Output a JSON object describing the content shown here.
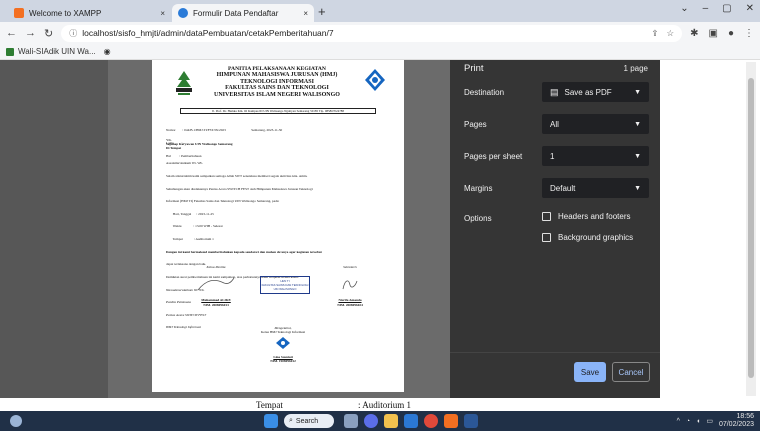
{
  "browser": {
    "tabs": [
      {
        "title": "Welcome to XAMPP",
        "close": "×"
      },
      {
        "title": "Formulir Data Pendaftar",
        "close": "×"
      }
    ],
    "new_tab": "+",
    "window_controls": [
      "⌄",
      "–",
      "▢",
      "✕"
    ],
    "url": "localhost/sisfo_hmjti/admin/dataPembuatan/cetakPemberitahuan/7",
    "bookmarks": [
      "Wali-SIAdik UIN Wa..."
    ]
  },
  "document": {
    "header_lines": [
      "PANITIA PELAKSANAAN KEGIATAN",
      "HIMPUNAN MAHASISWA JURUSAN (HMJ)",
      "TEKNOLOGI INFORMASI",
      "FAKULTAS SAINS DAN TEKNOLOGI",
      "UNIVERSITAS ISLAM NEGERI WALISONGO"
    ],
    "address": "Jl. Prof. Dr. Hamka Km. 02 Kampus III UIN Walisongo Ngaliyan Semarang 50185 Tlp. 085867024788",
    "meta_lines": [
      "Nomor        : 044/B.1/HMJ.TI/FST/IX/2023                              Semarang, 2023-11-30",
      "Lamp         : -",
      "Hal          : Pemberitahuan"
    ],
    "to_lines": [
      "Yth.",
      "Segenap Karyawan UIN Walisongo Semarang",
      "Di Tempat"
    ],
    "body_lines": [
      "Assalamu'alaikum Wr. Wb.",
      "Salam silaturrahim kami sampaikan semoga Allah SWT senantiasa memberi segala aktivitas kita. Amin.",
      "Sehubungan akan diadakannya Pentas Acara SWITCH FEST oleh Himpunan Mahasiswa Jurusan Teknologi",
      "Informasi (HMJ TI) Fakultas Sains dan Teknologi UIN Walisongo Semarang, pada:",
      "        Hari, Tanggal      : 2023-11-25",
      "        Waktu              : 13.00 WIB - Selesai",
      "        Tempat             : Auditorium 1",
      "Dengan ini kami bermaksud memberitahukan kepada saudara/i dan mohon do'anya agar kegiatan tersebut",
      "dapat terlaksana dengan baik.",
      "Demikian surat pemberitahuan ini kami sampaikan, atas perhatiannya kami ucapkan terima kasih.",
      "Wassalamu'alaikum Wr. Wb.",
      "Panitia Pelaksana",
      "Pentas Acara SWITCH FEST",
      "HMJ Teknologi Informasi"
    ],
    "sign_left_title": "Ketua Panitia",
    "sign_left_name": "Muhammad ALIKE",
    "sign_left_nim": "NIM. 2008096013",
    "sign_right_title": "Sekretaris",
    "sign_right_name": "Nisrifa Amanda",
    "sign_right_nim": "NIM. 2008096024",
    "stamp_text": [
      "HMJ TI",
      "FAKULTAS SAINS DAN TEKNOLOGI",
      "UIN WALISONGO"
    ],
    "know_label": "Mengetahui,",
    "know_title": "Ketua HMJ Teknologi Informasi",
    "know_name": "Lina Susniati",
    "know_nim": "NIM. 1908096012"
  },
  "page_behind": {
    "label": "Tempat",
    "value": ": Auditorium 1"
  },
  "print_panel": {
    "title": "Print",
    "page_count": "1 page",
    "destination_label": "Destination",
    "destination_value": "Save as PDF",
    "pages_label": "Pages",
    "pages_value": "All",
    "per_sheet_label": "Pages per sheet",
    "per_sheet_value": "1",
    "margins_label": "Margins",
    "margins_value": "Default",
    "options_label": "Options",
    "opt_headers": "Headers and footers",
    "opt_background": "Background graphics",
    "save_label": "Save",
    "cancel_label": "Cancel"
  },
  "taskbar": {
    "search_label": "Search",
    "time": "18:56",
    "date": "07/02/2023"
  },
  "colors": {
    "panel_bg": "#353535",
    "select_bg": "#202124",
    "save_blue": "#8ab4f8",
    "taskbar": "#203047"
  }
}
